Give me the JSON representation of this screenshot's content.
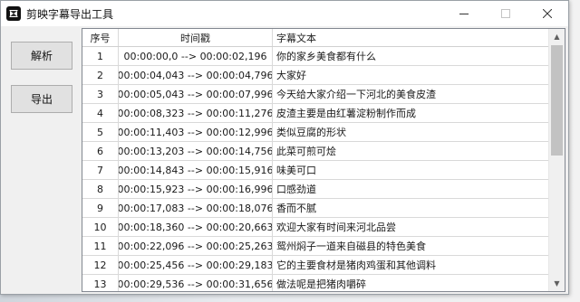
{
  "window": {
    "title": "剪映字幕导出工具"
  },
  "buttons": {
    "parse": "解析",
    "export": "导出"
  },
  "table": {
    "headers": [
      "序号",
      "时间戳",
      "字幕文本"
    ],
    "rows": [
      {
        "idx": "1",
        "time": "00:00:00,0 --> 00:00:02,196",
        "text": "你的家乡美食都有什么"
      },
      {
        "idx": "2",
        "time": "00:00:04,043 --> 00:00:04,796",
        "text": "大家好"
      },
      {
        "idx": "3",
        "time": "00:00:05,043 --> 00:00:07,996",
        "text": "今天给大家介绍一下河北的美食皮渣"
      },
      {
        "idx": "4",
        "time": "00:00:08,323 --> 00:00:11,276",
        "text": "皮渣主要是由红薯淀粉制作而成"
      },
      {
        "idx": "5",
        "time": "00:00:11,403 --> 00:00:12,996",
        "text": "类似豆腐的形状"
      },
      {
        "idx": "6",
        "time": "00:00:13,203 --> 00:00:14,756",
        "text": "此菜可煎可烩"
      },
      {
        "idx": "7",
        "time": "00:00:14,843 --> 00:00:15,916",
        "text": "味美可口"
      },
      {
        "idx": "8",
        "time": "00:00:15,923 --> 00:00:16,996",
        "text": "口感劲道"
      },
      {
        "idx": "9",
        "time": "00:00:17,083 --> 00:00:18,076",
        "text": "香而不腻"
      },
      {
        "idx": "10",
        "time": "00:00:18,360 --> 00:00:20,663",
        "text": "欢迎大家有时间来河北品尝"
      },
      {
        "idx": "11",
        "time": "00:00:22,096 --> 00:00:25,263",
        "text": "鸳州焖子一道来自磁县的特色美食"
      },
      {
        "idx": "12",
        "time": "00:00:25,456 --> 00:00:29,183",
        "text": "它的主要食材是猪肉鸡蛋和其他调料"
      },
      {
        "idx": "13",
        "time": "00:00:29,536 --> 00:00:31,656",
        "text": "做法呢是把猪肉嚼碎"
      }
    ]
  },
  "icons": {
    "app": "capcut-logo-icon",
    "minimize": "minimize-icon",
    "maximize": "maximize-icon",
    "close": "close-icon"
  }
}
